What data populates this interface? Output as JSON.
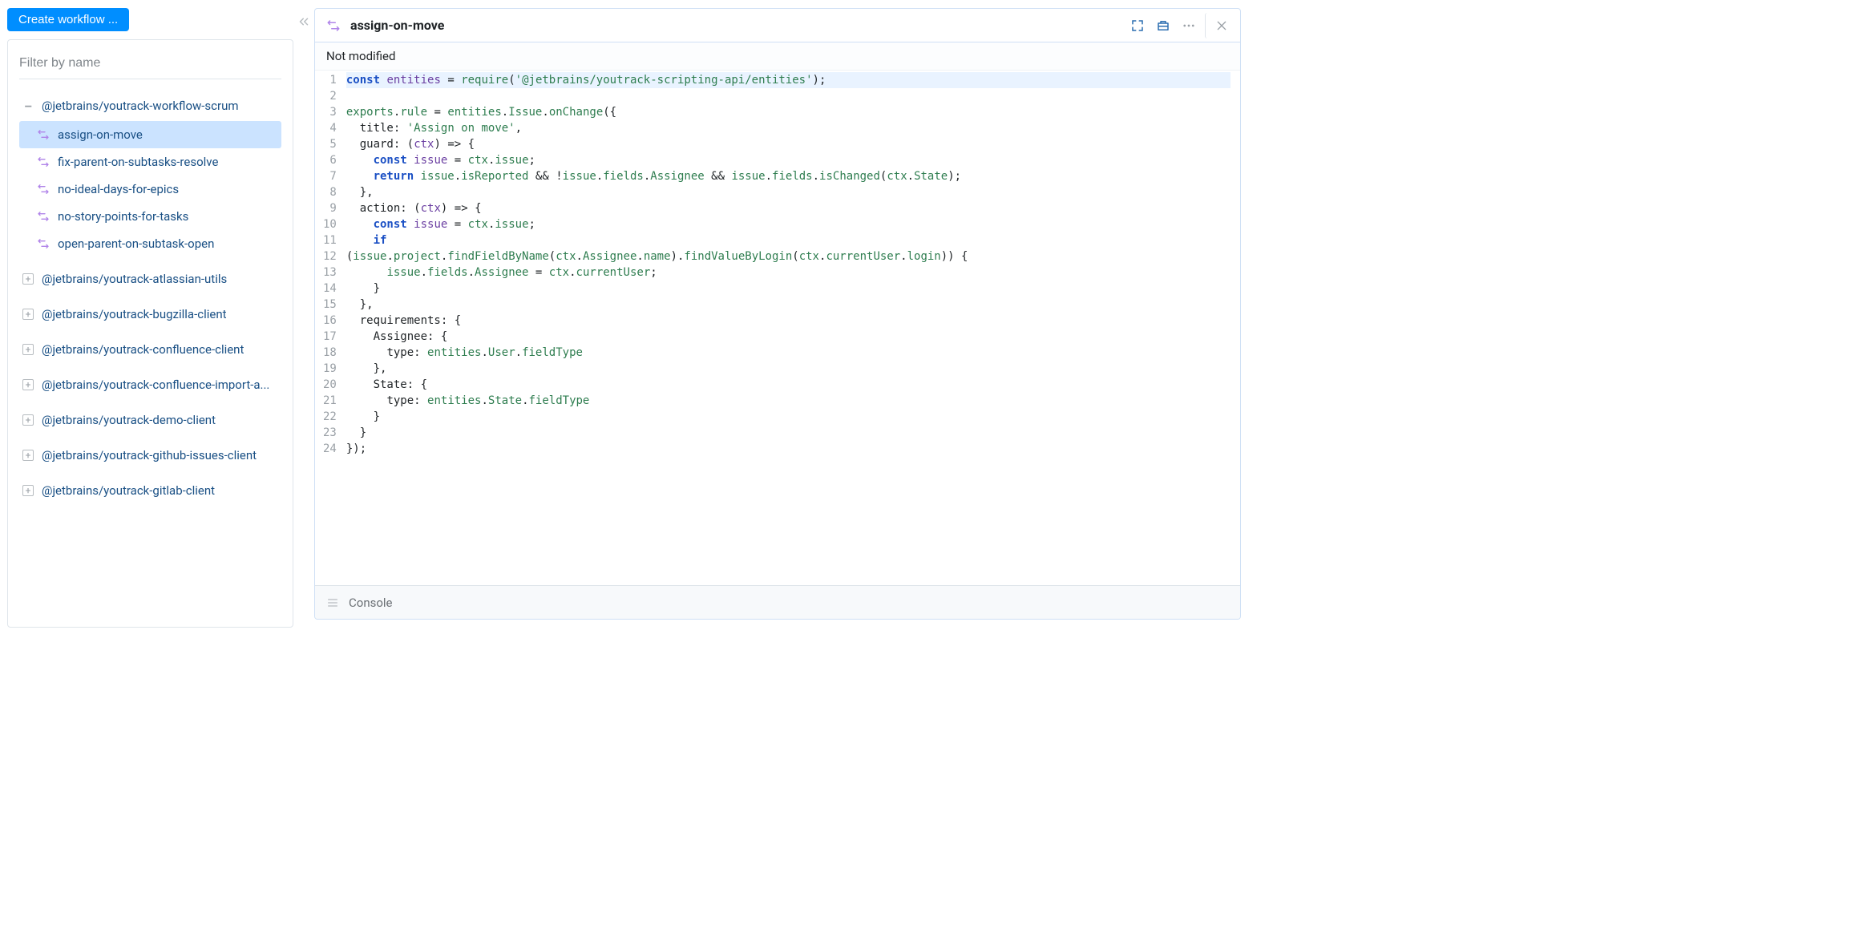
{
  "sidebar": {
    "create_label": "Create workflow ...",
    "filter_placeholder": "Filter by name",
    "expanded_group": {
      "name": "@jetbrains/youtrack-workflow-scrum",
      "children": [
        {
          "name": "assign-on-move",
          "selected": true
        },
        {
          "name": "fix-parent-on-subtasks-resolve",
          "selected": false
        },
        {
          "name": "no-ideal-days-for-epics",
          "selected": false
        },
        {
          "name": "no-story-points-for-tasks",
          "selected": false
        },
        {
          "name": "open-parent-on-subtask-open",
          "selected": false
        }
      ]
    },
    "collapsed_groups": [
      "@jetbrains/youtrack-atlassian-utils",
      "@jetbrains/youtrack-bugzilla-client",
      "@jetbrains/youtrack-confluence-client",
      "@jetbrains/youtrack-confluence-import-a...",
      "@jetbrains/youtrack-demo-client",
      "@jetbrains/youtrack-github-issues-client",
      "@jetbrains/youtrack-gitlab-client"
    ]
  },
  "editor": {
    "file_title": "assign-on-move",
    "status": "Not modified",
    "console_label": "Console",
    "lines": [
      [
        {
          "t": "kw",
          "v": "const"
        },
        {
          "t": "sp"
        },
        {
          "t": "var",
          "v": "entities"
        },
        {
          "t": "sp"
        },
        {
          "t": "op",
          "v": "="
        },
        {
          "t": "sp"
        },
        {
          "t": "fn",
          "v": "require"
        },
        {
          "t": "punc",
          "v": "("
        },
        {
          "t": "str",
          "v": "'@jetbrains/youtrack-scripting-api/entities'"
        },
        {
          "t": "punc",
          "v": ");"
        }
      ],
      [],
      [
        {
          "t": "prop",
          "v": "exports"
        },
        {
          "t": "punc",
          "v": "."
        },
        {
          "t": "prop",
          "v": "rule"
        },
        {
          "t": "sp"
        },
        {
          "t": "op",
          "v": "="
        },
        {
          "t": "sp"
        },
        {
          "t": "prop",
          "v": "entities"
        },
        {
          "t": "punc",
          "v": "."
        },
        {
          "t": "prop",
          "v": "Issue"
        },
        {
          "t": "punc",
          "v": "."
        },
        {
          "t": "fn",
          "v": "onChange"
        },
        {
          "t": "punc",
          "v": "({"
        }
      ],
      [
        {
          "t": "indent",
          "n": 2
        },
        {
          "t": "key",
          "v": "title"
        },
        {
          "t": "punc",
          "v": ":"
        },
        {
          "t": "sp"
        },
        {
          "t": "str",
          "v": "'Assign on move'"
        },
        {
          "t": "punc",
          "v": ","
        }
      ],
      [
        {
          "t": "indent",
          "n": 2
        },
        {
          "t": "key",
          "v": "guard"
        },
        {
          "t": "punc",
          "v": ":"
        },
        {
          "t": "sp"
        },
        {
          "t": "punc",
          "v": "("
        },
        {
          "t": "param",
          "v": "ctx"
        },
        {
          "t": "punc",
          "v": ")"
        },
        {
          "t": "sp"
        },
        {
          "t": "op",
          "v": "=>"
        },
        {
          "t": "sp"
        },
        {
          "t": "punc",
          "v": "{"
        }
      ],
      [
        {
          "t": "indent",
          "n": 4
        },
        {
          "t": "kw",
          "v": "const"
        },
        {
          "t": "sp"
        },
        {
          "t": "var",
          "v": "issue"
        },
        {
          "t": "sp"
        },
        {
          "t": "op",
          "v": "="
        },
        {
          "t": "sp"
        },
        {
          "t": "prop",
          "v": "ctx"
        },
        {
          "t": "punc",
          "v": "."
        },
        {
          "t": "prop",
          "v": "issue"
        },
        {
          "t": "punc",
          "v": ";"
        }
      ],
      [
        {
          "t": "indent",
          "n": 4
        },
        {
          "t": "kw",
          "v": "return"
        },
        {
          "t": "sp"
        },
        {
          "t": "prop",
          "v": "issue"
        },
        {
          "t": "punc",
          "v": "."
        },
        {
          "t": "prop",
          "v": "isReported"
        },
        {
          "t": "sp"
        },
        {
          "t": "op",
          "v": "&&"
        },
        {
          "t": "sp"
        },
        {
          "t": "op",
          "v": "!"
        },
        {
          "t": "prop",
          "v": "issue"
        },
        {
          "t": "punc",
          "v": "."
        },
        {
          "t": "prop",
          "v": "fields"
        },
        {
          "t": "punc",
          "v": "."
        },
        {
          "t": "prop",
          "v": "Assignee"
        },
        {
          "t": "sp"
        },
        {
          "t": "op",
          "v": "&&"
        },
        {
          "t": "sp"
        },
        {
          "t": "prop",
          "v": "issue"
        },
        {
          "t": "punc",
          "v": "."
        },
        {
          "t": "prop",
          "v": "fields"
        },
        {
          "t": "punc",
          "v": "."
        },
        {
          "t": "fn",
          "v": "isChanged"
        },
        {
          "t": "punc",
          "v": "("
        },
        {
          "t": "prop",
          "v": "ctx"
        },
        {
          "t": "punc",
          "v": "."
        },
        {
          "t": "prop",
          "v": "State"
        },
        {
          "t": "punc",
          "v": ");"
        }
      ],
      [
        {
          "t": "indent",
          "n": 2
        },
        {
          "t": "punc",
          "v": "},"
        }
      ],
      [
        {
          "t": "indent",
          "n": 2
        },
        {
          "t": "key",
          "v": "action"
        },
        {
          "t": "punc",
          "v": ":"
        },
        {
          "t": "sp"
        },
        {
          "t": "punc",
          "v": "("
        },
        {
          "t": "param",
          "v": "ctx"
        },
        {
          "t": "punc",
          "v": ")"
        },
        {
          "t": "sp"
        },
        {
          "t": "op",
          "v": "=>"
        },
        {
          "t": "sp"
        },
        {
          "t": "punc",
          "v": "{"
        }
      ],
      [
        {
          "t": "indent",
          "n": 4
        },
        {
          "t": "kw",
          "v": "const"
        },
        {
          "t": "sp"
        },
        {
          "t": "var",
          "v": "issue"
        },
        {
          "t": "sp"
        },
        {
          "t": "op",
          "v": "="
        },
        {
          "t": "sp"
        },
        {
          "t": "prop",
          "v": "ctx"
        },
        {
          "t": "punc",
          "v": "."
        },
        {
          "t": "prop",
          "v": "issue"
        },
        {
          "t": "punc",
          "v": ";"
        }
      ],
      [
        {
          "t": "indent",
          "n": 4
        },
        {
          "t": "kw",
          "v": "if"
        }
      ],
      [
        {
          "t": "punc",
          "v": "("
        },
        {
          "t": "prop",
          "v": "issue"
        },
        {
          "t": "punc",
          "v": "."
        },
        {
          "t": "prop",
          "v": "project"
        },
        {
          "t": "punc",
          "v": "."
        },
        {
          "t": "fn",
          "v": "findFieldByName"
        },
        {
          "t": "punc",
          "v": "("
        },
        {
          "t": "prop",
          "v": "ctx"
        },
        {
          "t": "punc",
          "v": "."
        },
        {
          "t": "prop",
          "v": "Assignee"
        },
        {
          "t": "punc",
          "v": "."
        },
        {
          "t": "prop",
          "v": "name"
        },
        {
          "t": "punc",
          "v": ")."
        },
        {
          "t": "fn",
          "v": "findValueByLogin"
        },
        {
          "t": "punc",
          "v": "("
        },
        {
          "t": "prop",
          "v": "ctx"
        },
        {
          "t": "punc",
          "v": "."
        },
        {
          "t": "prop",
          "v": "currentUser"
        },
        {
          "t": "punc",
          "v": "."
        },
        {
          "t": "prop",
          "v": "login"
        },
        {
          "t": "punc",
          "v": "))"
        },
        {
          "t": "sp"
        },
        {
          "t": "punc",
          "v": "{"
        }
      ],
      [
        {
          "t": "indent",
          "n": 6
        },
        {
          "t": "prop",
          "v": "issue"
        },
        {
          "t": "punc",
          "v": "."
        },
        {
          "t": "prop",
          "v": "fields"
        },
        {
          "t": "punc",
          "v": "."
        },
        {
          "t": "prop",
          "v": "Assignee"
        },
        {
          "t": "sp"
        },
        {
          "t": "op",
          "v": "="
        },
        {
          "t": "sp"
        },
        {
          "t": "prop",
          "v": "ctx"
        },
        {
          "t": "punc",
          "v": "."
        },
        {
          "t": "prop",
          "v": "currentUser"
        },
        {
          "t": "punc",
          "v": ";"
        }
      ],
      [
        {
          "t": "indent",
          "n": 4
        },
        {
          "t": "punc",
          "v": "}"
        }
      ],
      [
        {
          "t": "indent",
          "n": 2
        },
        {
          "t": "punc",
          "v": "},"
        }
      ],
      [
        {
          "t": "indent",
          "n": 2
        },
        {
          "t": "key",
          "v": "requirements"
        },
        {
          "t": "punc",
          "v": ":"
        },
        {
          "t": "sp"
        },
        {
          "t": "punc",
          "v": "{"
        }
      ],
      [
        {
          "t": "indent",
          "n": 4
        },
        {
          "t": "key",
          "v": "Assignee"
        },
        {
          "t": "punc",
          "v": ":"
        },
        {
          "t": "sp"
        },
        {
          "t": "punc",
          "v": "{"
        }
      ],
      [
        {
          "t": "indent",
          "n": 6
        },
        {
          "t": "key",
          "v": "type"
        },
        {
          "t": "punc",
          "v": ":"
        },
        {
          "t": "sp"
        },
        {
          "t": "prop",
          "v": "entities"
        },
        {
          "t": "punc",
          "v": "."
        },
        {
          "t": "prop",
          "v": "User"
        },
        {
          "t": "punc",
          "v": "."
        },
        {
          "t": "prop",
          "v": "fieldType"
        }
      ],
      [
        {
          "t": "indent",
          "n": 4
        },
        {
          "t": "punc",
          "v": "},"
        }
      ],
      [
        {
          "t": "indent",
          "n": 4
        },
        {
          "t": "key",
          "v": "State"
        },
        {
          "t": "punc",
          "v": ":"
        },
        {
          "t": "sp"
        },
        {
          "t": "punc",
          "v": "{"
        }
      ],
      [
        {
          "t": "indent",
          "n": 6
        },
        {
          "t": "key",
          "v": "type"
        },
        {
          "t": "punc",
          "v": ":"
        },
        {
          "t": "sp"
        },
        {
          "t": "prop",
          "v": "entities"
        },
        {
          "t": "punc",
          "v": "."
        },
        {
          "t": "prop",
          "v": "State"
        },
        {
          "t": "punc",
          "v": "."
        },
        {
          "t": "prop",
          "v": "fieldType"
        }
      ],
      [
        {
          "t": "indent",
          "n": 4
        },
        {
          "t": "punc",
          "v": "}"
        }
      ],
      [
        {
          "t": "indent",
          "n": 2
        },
        {
          "t": "punc",
          "v": "}"
        }
      ],
      [
        {
          "t": "punc",
          "v": "});"
        }
      ]
    ],
    "active_line": 1
  },
  "colors": {
    "accent": "#008eff",
    "link": "#1a5085",
    "icon_purple": "#b084e9"
  }
}
